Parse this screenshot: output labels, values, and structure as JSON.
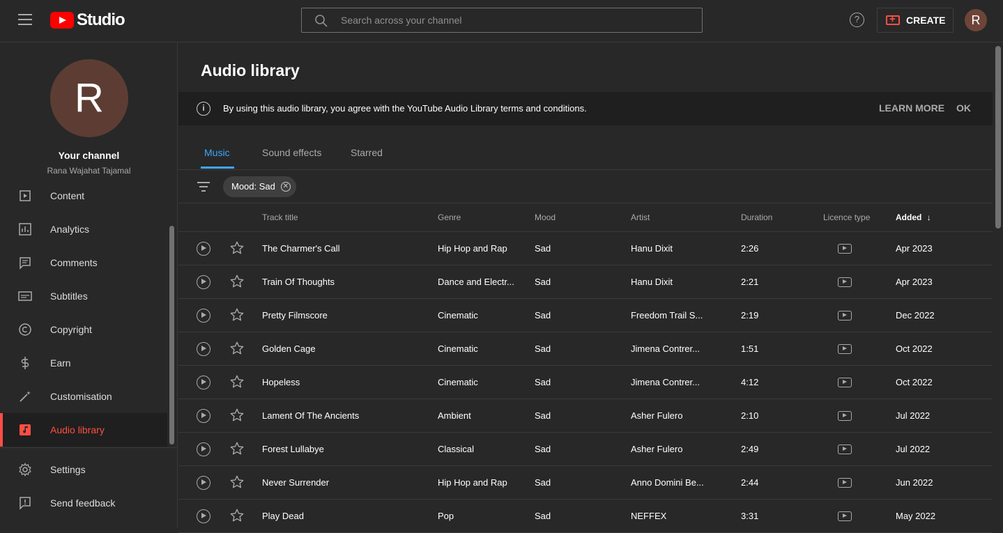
{
  "header": {
    "logo_text": "Studio",
    "search_placeholder": "Search across your channel",
    "help_glyph": "?",
    "create_label": "CREATE",
    "avatar_letter": "R"
  },
  "sidebar": {
    "avatar_letter": "R",
    "your_channel": "Your channel",
    "channel_name": "Rana Wajahat Tajamal",
    "items": [
      {
        "label": "Content",
        "icon": "content-icon"
      },
      {
        "label": "Analytics",
        "icon": "analytics-icon"
      },
      {
        "label": "Comments",
        "icon": "comments-icon"
      },
      {
        "label": "Subtitles",
        "icon": "subtitles-icon"
      },
      {
        "label": "Copyright",
        "icon": "copyright-icon"
      },
      {
        "label": "Earn",
        "icon": "dollar-icon"
      },
      {
        "label": "Customisation",
        "icon": "magic-wand-icon"
      },
      {
        "label": "Audio library",
        "icon": "audio-library-icon",
        "active": true
      }
    ],
    "bottom_items": [
      {
        "label": "Settings",
        "icon": "gear-icon"
      },
      {
        "label": "Send feedback",
        "icon": "feedback-icon"
      }
    ]
  },
  "main": {
    "title": "Audio library",
    "banner": {
      "info_glyph": "i",
      "text": "By using this audio library, you agree with the YouTube Audio Library terms and conditions.",
      "learn_more": "LEARN MORE",
      "ok": "OK"
    },
    "tabs": [
      {
        "label": "Music",
        "active": true
      },
      {
        "label": "Sound effects"
      },
      {
        "label": "Starred"
      }
    ],
    "filter_chip": "Mood: Sad",
    "chip_close_glyph": "✕",
    "columns": {
      "title": "Track title",
      "genre": "Genre",
      "mood": "Mood",
      "artist": "Artist",
      "duration": "Duration",
      "licence": "Licence type",
      "added": "Added",
      "sort_glyph": "↓"
    },
    "rows": [
      {
        "title": "The Charmer's Call",
        "genre": "Hip Hop and Rap",
        "mood": "Sad",
        "artist": "Hanu Dixit",
        "duration": "2:26",
        "added": "Apr 2023"
      },
      {
        "title": "Train Of Thoughts",
        "genre": "Dance and Electr...",
        "mood": "Sad",
        "artist": "Hanu Dixit",
        "duration": "2:21",
        "added": "Apr 2023"
      },
      {
        "title": "Pretty Filmscore",
        "genre": "Cinematic",
        "mood": "Sad",
        "artist": "Freedom Trail S...",
        "duration": "2:19",
        "added": "Dec 2022"
      },
      {
        "title": "Golden Cage",
        "genre": "Cinematic",
        "mood": "Sad",
        "artist": "Jimena Contrer...",
        "duration": "1:51",
        "added": "Oct 2022"
      },
      {
        "title": "Hopeless",
        "genre": "Cinematic",
        "mood": "Sad",
        "artist": "Jimena Contrer...",
        "duration": "4:12",
        "added": "Oct 2022"
      },
      {
        "title": "Lament Of The Ancients",
        "genre": "Ambient",
        "mood": "Sad",
        "artist": "Asher Fulero",
        "duration": "2:10",
        "added": "Jul 2022"
      },
      {
        "title": "Forest Lullabye",
        "genre": "Classical",
        "mood": "Sad",
        "artist": "Asher Fulero",
        "duration": "2:49",
        "added": "Jul 2022"
      },
      {
        "title": "Never Surrender",
        "genre": "Hip Hop and Rap",
        "mood": "Sad",
        "artist": "Anno Domini Be...",
        "duration": "2:44",
        "added": "Jun 2022"
      },
      {
        "title": "Play Dead",
        "genre": "Pop",
        "mood": "Sad",
        "artist": "NEFFEX",
        "duration": "3:31",
        "added": "May 2022"
      }
    ]
  }
}
